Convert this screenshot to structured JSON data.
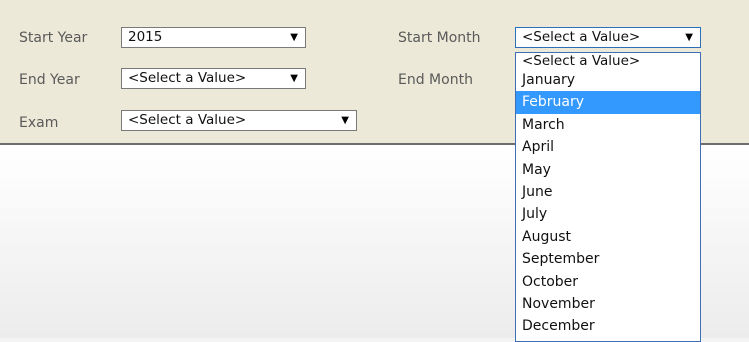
{
  "params": {
    "start_year": {
      "label": "Start Year",
      "value": "2015"
    },
    "end_year": {
      "label": "End Year",
      "value": "<Select a Value>"
    },
    "exam": {
      "label": "Exam",
      "value": "<Select a Value>"
    },
    "start_month": {
      "label": "Start Month",
      "value": "<Select a Value>"
    },
    "end_month": {
      "label": "End Month"
    }
  },
  "dropdown": {
    "highlighted": "February",
    "options": [
      "<Select a Value>",
      "January",
      "February",
      "March",
      "April",
      "May",
      "June",
      "July",
      "August",
      "September",
      "October",
      "November",
      "December"
    ]
  },
  "icons": {
    "dropdown_arrow": "triangle-down"
  }
}
